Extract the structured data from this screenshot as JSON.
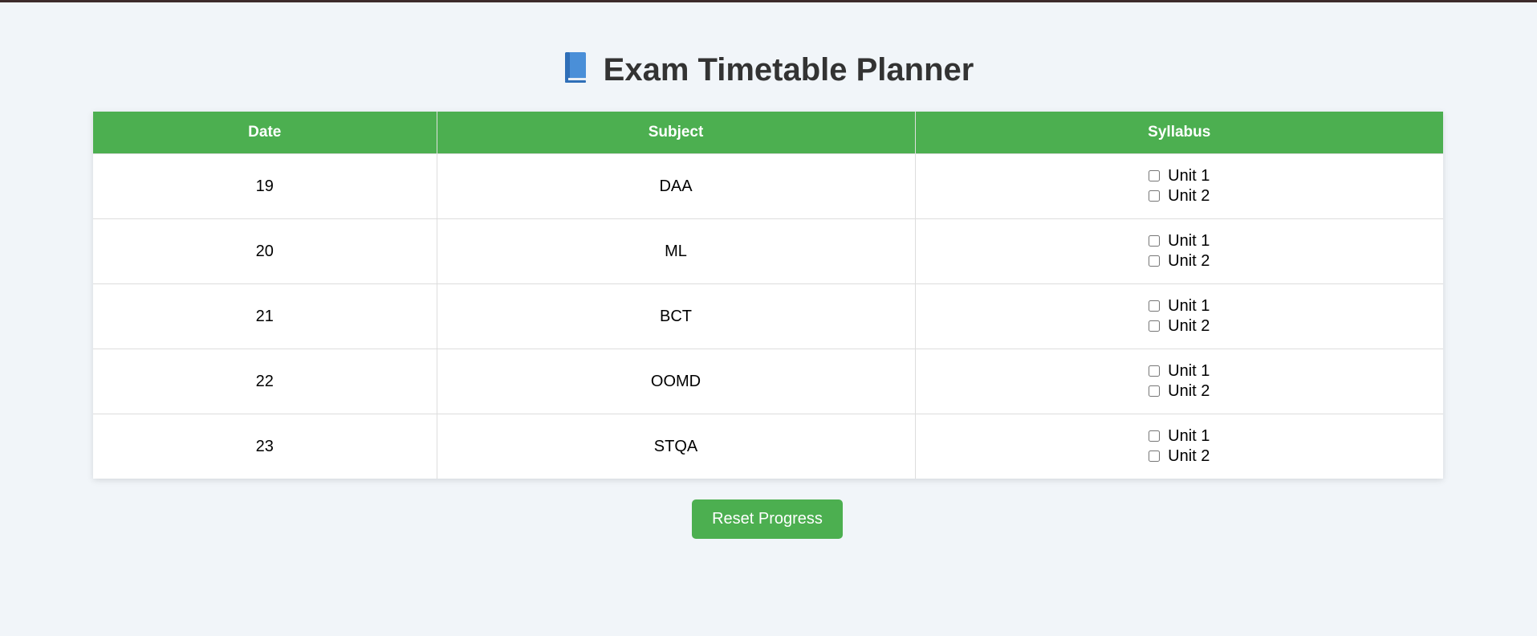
{
  "header": {
    "icon": "blue-book-icon",
    "title": "Exam Timetable Planner"
  },
  "table": {
    "columns": [
      "Date",
      "Subject",
      "Syllabus"
    ],
    "rows": [
      {
        "date": "19",
        "subject": "DAA",
        "units": [
          {
            "label": "Unit 1",
            "checked": false
          },
          {
            "label": "Unit 2",
            "checked": false
          }
        ]
      },
      {
        "date": "20",
        "subject": "ML",
        "units": [
          {
            "label": "Unit 1",
            "checked": false
          },
          {
            "label": "Unit 2",
            "checked": false
          }
        ]
      },
      {
        "date": "21",
        "subject": "BCT",
        "units": [
          {
            "label": "Unit 1",
            "checked": false
          },
          {
            "label": "Unit 2",
            "checked": false
          }
        ]
      },
      {
        "date": "22",
        "subject": "OOMD",
        "units": [
          {
            "label": "Unit 1",
            "checked": false
          },
          {
            "label": "Unit 2",
            "checked": false
          }
        ]
      },
      {
        "date": "23",
        "subject": "STQA",
        "units": [
          {
            "label": "Unit 1",
            "checked": false
          },
          {
            "label": "Unit 2",
            "checked": false
          }
        ]
      }
    ]
  },
  "actions": {
    "reset_label": "Reset Progress"
  },
  "colors": {
    "accent": "#4caf50",
    "background": "#f1f5f9",
    "title": "#333333"
  }
}
